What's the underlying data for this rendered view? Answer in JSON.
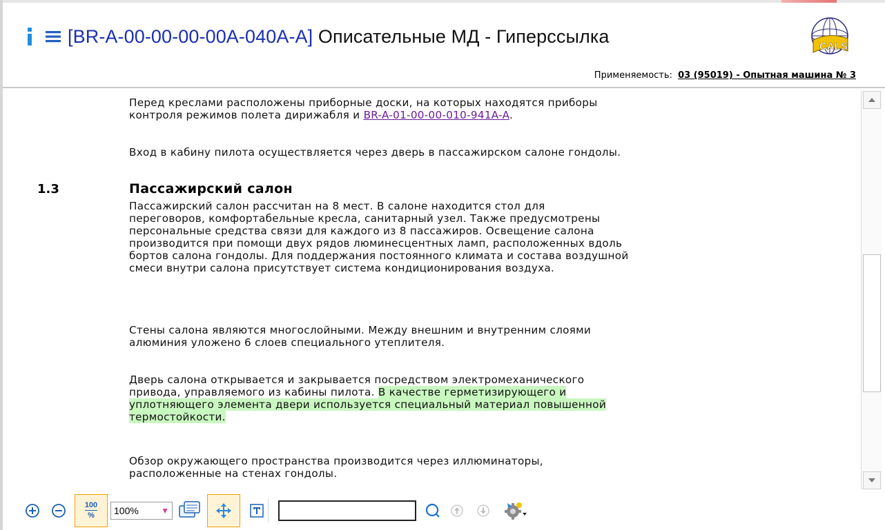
{
  "header": {
    "code": "BR-A-00-00-00-00A-040A-A",
    "title_rest": " Описательные МД - Гиперссылка",
    "open_bracket": "[",
    "close_bracket": "]"
  },
  "applicability": {
    "label": "Применяемость:",
    "value": "03 (95019) - Опытная машина № 3"
  },
  "content": {
    "p1_text": "Перед креслами расположены приборные доски, на которых находятся приборы\nконтроля режимов полета дирижабля и ",
    "p1_link": "BR-A-01-00-00-010-941A-A",
    "p1_end": ".",
    "p2": "Вход в кабину пилота осуществляется через дверь в пассажирском салоне гондолы.",
    "section_number": "1.3",
    "section_title": "Пассажирский салон",
    "p3": "Пассажирский салон рассчитан на 8 мест. В салоне находится стол для\nпереговоров, комфортабельные кресла, санитарный узел. Также предусмотрены\nперсональные средства связи для каждого из 8 пассажиров. Освещение салона\nпроизводится при помощи двух рядов люминесцентных ламп, расположенных вдоль\nбортов салона гондолы. Для поддержания постоянного климата и состава воздушной\nсмеси внутри салона присутствует система кондиционирования воздуха.",
    "p4": "Стены салона являются многослойными. Между внешним и внутренним слоями\nалюминия уложено 6 слоев специального утеплителя.",
    "p5_plain": "Дверь салона открывается и закрывается посредством электромеханического\nпривода, управляемого из кабины пилота. ",
    "p5_hl1": "В качестве герметизирующего и ",
    "p5_hl2": "уплотняющего элемента двери используется специальный материал повышенной ",
    "p5_hl3": "термостойкости.",
    "p6": "Обзор окружающего пространства производится через иллюминаторы,\nрасположенные на стенах гондолы."
  },
  "scrollbar": {
    "position_fraction": 0.65
  },
  "toolbar": {
    "zoom_100_top": "100",
    "zoom_100_bottom": "%",
    "zoom_value": "100%",
    "search_value": ""
  },
  "colors": {
    "code_blue": "#1a2fb0",
    "link_purple": "#6a1b9a",
    "highlight_green": "#c9f7c0",
    "active_orange": "#f0a000"
  },
  "icons": [
    "info-icon",
    "menu-icon",
    "cals-logo",
    "zoom-in-icon",
    "zoom-out-icon",
    "zoom-100-icon",
    "comment-icon",
    "move-icon",
    "fit-text-icon",
    "search-icon",
    "prev-match-icon",
    "next-match-icon",
    "settings-icon"
  ]
}
